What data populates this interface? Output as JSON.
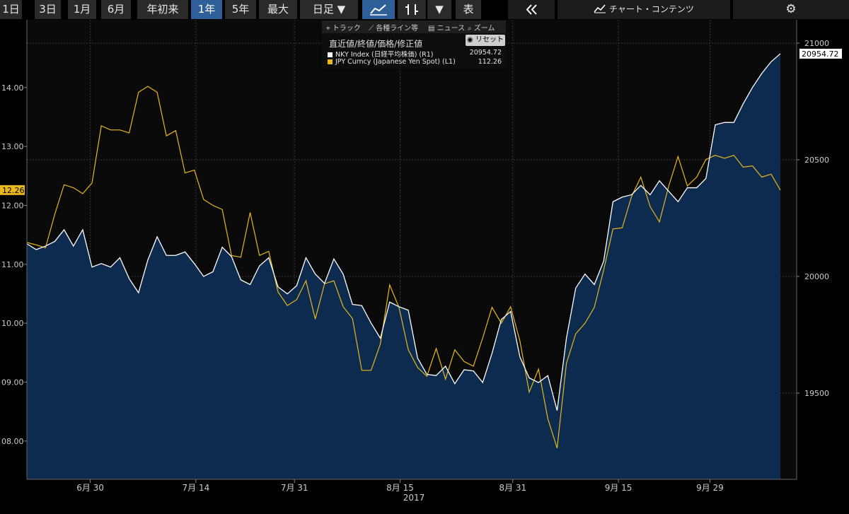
{
  "toolbar": {
    "ranges": [
      "1日",
      "3日",
      "1月",
      "6月",
      "年初来",
      "1年",
      "5年",
      "最大"
    ],
    "active_range": "1年",
    "period_label": "日足 ▼",
    "table_label": "表",
    "collapse_icon": "double-chevron-left-icon",
    "chart_contents_label": "チャート・コンテンツ",
    "settings_icon": "gear-icon"
  },
  "legend": {
    "tools": {
      "track": "トラック",
      "lines": "各種ライン等",
      "news": "ニュース",
      "zoom": "ズーム"
    },
    "reset_label": "リセット",
    "header": "直近値/終値/価格/修正値",
    "rows": [
      {
        "label": "NKY Index (日経平均株価) (R1)",
        "value": "20954.72",
        "color": "#ffffff"
      },
      {
        "label": "JPY Curncy (Japanese Yen Spot) (L1)",
        "value": "112.26",
        "color": "#e8b81c"
      }
    ]
  },
  "colors": {
    "nky_line": "#ffffff",
    "nky_fill": "#0d2a4f",
    "jpy_line": "#e8b81c",
    "background": "#000000"
  },
  "chart_data": {
    "type": "line",
    "x_labels": [
      "6月 30",
      "7月 14",
      "7月 31",
      "8月 15",
      "8月 31",
      "9月 15",
      "9月 29"
    ],
    "x_year_label": "2017",
    "left_axis": {
      "tick_labels": [
        "14.00",
        "13.00",
        "12.00",
        "11.00",
        "10.00",
        "09.00",
        "08.00"
      ],
      "ylim": [
        107.35,
        115.15
      ],
      "current_label": "12.26"
    },
    "right_axis": {
      "tick_labels": [
        "21000",
        "20500",
        "20000",
        "19500"
      ],
      "ylim": [
        19130,
        21100
      ],
      "current_label": "20954.72"
    },
    "series": [
      {
        "name": "JPY Curncy (Japanese Yen Spot) (L1)",
        "axis": "left",
        "values": [
          111.37,
          111.33,
          111.28,
          111.85,
          112.35,
          112.3,
          112.2,
          112.38,
          113.35,
          113.28,
          113.28,
          113.23,
          113.92,
          114.02,
          113.92,
          113.18,
          113.27,
          112.55,
          112.6,
          112.1,
          112.0,
          111.93,
          111.15,
          111.12,
          111.88,
          111.15,
          111.22,
          110.53,
          110.3,
          110.4,
          110.72,
          110.07,
          110.67,
          110.72,
          110.28,
          110.08,
          109.2,
          109.2,
          109.65,
          110.65,
          110.27,
          109.55,
          109.25,
          109.1,
          109.57,
          109.05,
          109.55,
          109.35,
          109.27,
          109.75,
          110.27,
          110.0,
          110.28,
          109.7,
          108.83,
          109.22,
          108.38,
          107.88,
          109.32,
          109.82,
          110.0,
          110.27,
          110.9,
          111.6,
          111.62,
          112.15,
          112.48,
          111.98,
          111.72,
          112.33,
          112.83,
          112.33,
          112.48,
          112.78,
          112.85,
          112.8,
          112.85,
          112.65,
          112.67,
          112.48,
          112.53,
          112.26
        ]
      },
      {
        "name": "NKY Index (日経平均株価) (R1)",
        "axis": "right",
        "values": [
          20140,
          20115,
          20130,
          20150,
          20200,
          20130,
          20200,
          20040,
          20055,
          20040,
          20080,
          19990,
          19930,
          20070,
          20170,
          20090,
          20090,
          20105,
          20055,
          20000,
          20020,
          20125,
          20085,
          19985,
          19965,
          20045,
          20080,
          19955,
          19925,
          19960,
          20080,
          20010,
          19970,
          20075,
          20010,
          19880,
          19875,
          19800,
          19735,
          19890,
          19870,
          19855,
          19650,
          19580,
          19575,
          19615,
          19540,
          19600,
          19595,
          19545,
          19670,
          19815,
          19850,
          19655,
          19565,
          19545,
          19575,
          19425,
          19735,
          19950,
          20010,
          19965,
          20065,
          20320,
          20340,
          20350,
          20390,
          20350,
          20410,
          20365,
          20320,
          20380,
          20380,
          20420,
          20650,
          20660,
          20660,
          20740,
          20810,
          20870,
          20920,
          20954.72
        ]
      }
    ]
  }
}
